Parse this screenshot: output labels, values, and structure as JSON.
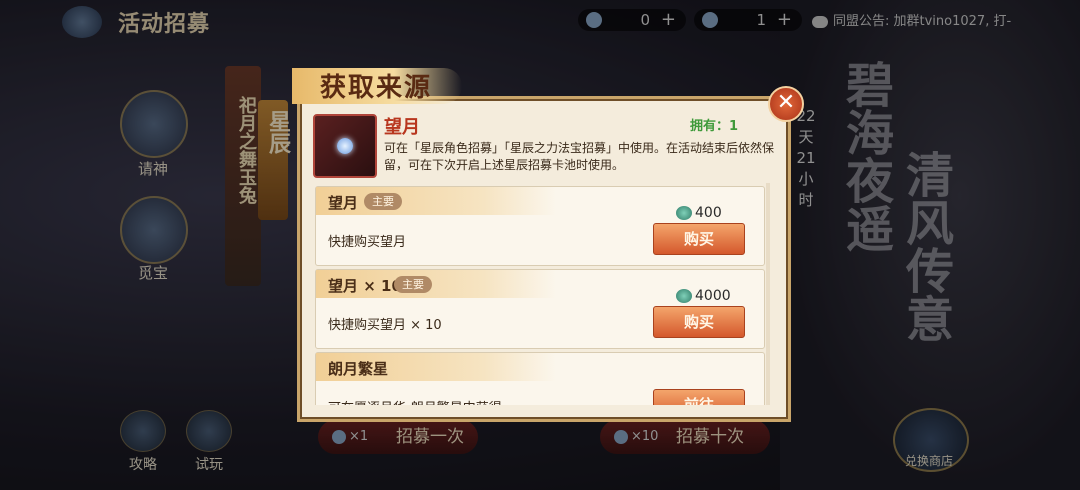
{
  "header": {
    "title": "活动招募",
    "resource1": "0",
    "resource2": "1",
    "notice": "同盟公告: 加群tvino1027, 打-"
  },
  "side": {
    "qingshen": "请神",
    "mibao": "觅宝",
    "gonglue": "攻略",
    "shiwan": "试玩",
    "banner_text": "祀月之舞玉兔",
    "banner_tag": "星辰"
  },
  "countdown": "22天21小时",
  "calligraphy": [
    "碧海夜遥",
    "清风传意"
  ],
  "bottom": {
    "recruit_one": "招募一次",
    "recruit_ten": "招募十次",
    "cost_one": "×1",
    "cost_ten": "×10",
    "shop": "兑换商店"
  },
  "modal": {
    "title": "获取来源",
    "close": "✕",
    "item_name": "望月",
    "owned": "拥有：1",
    "description": "可在「星辰角色招募」「星辰之力法宝招募」中使用。在活动结束后依然保留，可在下次开启上述星辰招募卡池时使用。",
    "sources": [
      {
        "name": "望月",
        "tag": "主要",
        "desc": "快捷购买望月",
        "price": "400",
        "action": "购买"
      },
      {
        "name": "望月 × 10",
        "tag": "主要",
        "desc": "快捷购买望月 × 10",
        "price": "4000",
        "action": "购买"
      },
      {
        "name": "朗月繁星",
        "tag": "",
        "desc": "可在愿逐月华-朗月繁星中获得",
        "price": "",
        "action": "前往"
      }
    ]
  }
}
